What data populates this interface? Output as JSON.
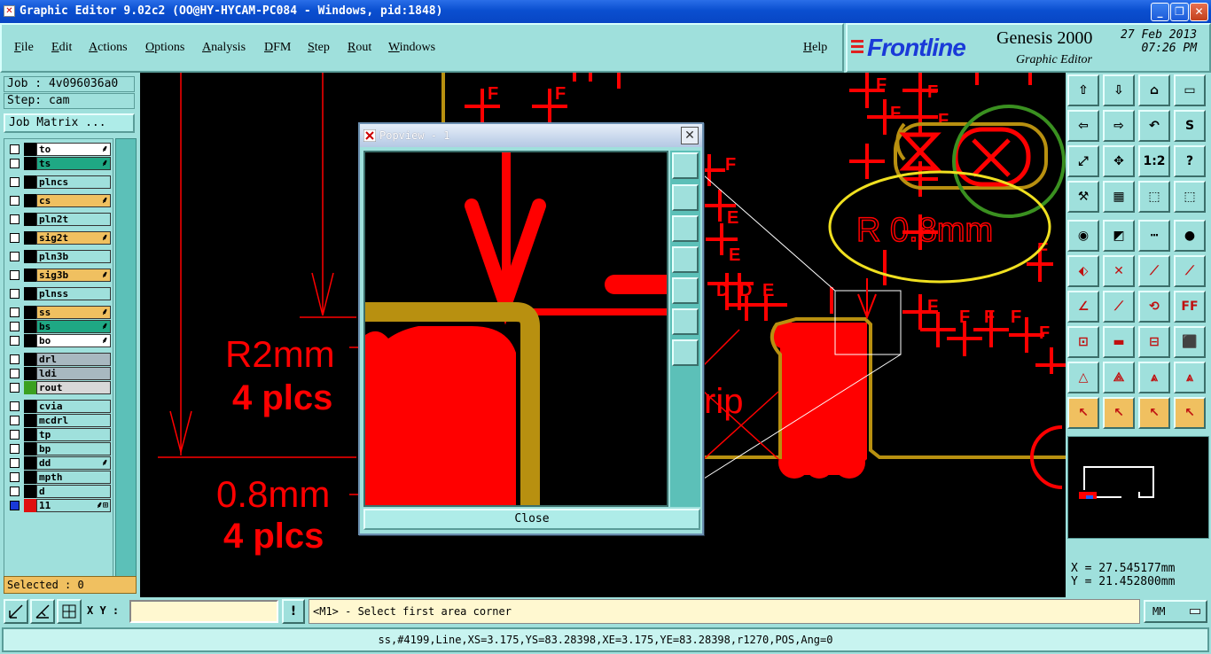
{
  "window": {
    "title": "Graphic Editor 9.02c2 (OO@HY-HYCAM-PC084 - Windows, pid:1848)",
    "min": "_",
    "max": "❐",
    "close": "✕"
  },
  "menu": {
    "items": [
      "File",
      "Edit",
      "Actions",
      "Options",
      "Analysis",
      "DFM",
      "Step",
      "Rout",
      "Windows"
    ],
    "help": "Help"
  },
  "branding": {
    "logo": "Frontline",
    "product": "Genesis 2000",
    "subtitle": "Graphic Editor",
    "date": "27 Feb 2013",
    "time": "07:26 PM"
  },
  "job": {
    "job_label": "Job : 4v096036a0",
    "step_label": "Step: cam",
    "matrix_button": "Job Matrix ..."
  },
  "layers": [
    {
      "name": "to",
      "bg": "#ffffff",
      "swatch": "#000000",
      "mark": "⸙"
    },
    {
      "name": "ts",
      "bg": "#1fa884",
      "swatch": "#000000",
      "mark": "⸙"
    },
    {
      "name": "plncs",
      "bg": "#9fe0dc",
      "swatch": "#000000",
      "mark": ""
    },
    {
      "name": "cs",
      "bg": "#f0c060",
      "swatch": "#000000",
      "mark": "⸙"
    },
    {
      "name": "pln2t",
      "bg": "#9fe0dc",
      "swatch": "#000000",
      "mark": ""
    },
    {
      "name": "sig2t",
      "bg": "#f0c060",
      "swatch": "#000000",
      "mark": "⸙"
    },
    {
      "name": "pln3b",
      "bg": "#9fe0dc",
      "swatch": "#000000",
      "mark": ""
    },
    {
      "name": "sig3b",
      "bg": "#f0c060",
      "swatch": "#000000",
      "mark": "⸙"
    },
    {
      "name": "plnss",
      "bg": "#9fe0dc",
      "swatch": "#000000",
      "mark": ""
    },
    {
      "name": "ss",
      "bg": "#f0c060",
      "swatch": "#000000",
      "mark": "⸙"
    },
    {
      "name": "bs",
      "bg": "#1fa884",
      "swatch": "#000000",
      "mark": "⸙"
    },
    {
      "name": "bo",
      "bg": "#ffffff",
      "swatch": "#000000",
      "mark": "⸙"
    },
    {
      "name": "drl",
      "bg": "#a8b8c0",
      "swatch": "#000000",
      "mark": ""
    },
    {
      "name": "ldi",
      "bg": "#a8b8c0",
      "swatch": "#000000",
      "mark": ""
    },
    {
      "name": "rout",
      "bg": "#d8d8d8",
      "swatch": "#3aa020",
      "mark": ""
    },
    {
      "name": "cvia",
      "bg": "#9fe0dc",
      "swatch": "#000000",
      "mark": ""
    },
    {
      "name": "mcdrl",
      "bg": "#9fe0dc",
      "swatch": "#000000",
      "mark": ""
    },
    {
      "name": "tp",
      "bg": "#9fe0dc",
      "swatch": "#000000",
      "mark": ""
    },
    {
      "name": "bp",
      "bg": "#9fe0dc",
      "swatch": "#000000",
      "mark": ""
    },
    {
      "name": "dd",
      "bg": "#9fe0dc",
      "swatch": "#000000",
      "mark": "⸙"
    },
    {
      "name": "mpth",
      "bg": "#9fe0dc",
      "swatch": "#000000",
      "mark": ""
    },
    {
      "name": "d",
      "bg": "#9fe0dc",
      "swatch": "#000000",
      "mark": ""
    },
    {
      "name": "11",
      "bg": "#9fe0dc",
      "swatch": "#e01010",
      "mark": "⸙⊞"
    }
  ],
  "selected": "Selected : 0",
  "canvas_text": {
    "r2": "R2mm",
    "plcs1": "4 plcs",
    "d08": "0.8mm",
    "plcs2": "4 plcs",
    "r08": "R 0.8mm",
    "rip": "rip"
  },
  "popview": {
    "title": "Popview - 1",
    "close_button": "Close"
  },
  "coords": {
    "x": "X =  27.545177mm",
    "y": "Y =  21.452800mm"
  },
  "bottom": {
    "xy_label": "X Y :",
    "xy_value": "",
    "message": "<M1> - Select first area corner",
    "units": "MM",
    "status": "ss,#4199,Line,XS=3.175,YS=83.28398,XE=3.175,YE=83.28398,r1270,POS,Ang=0"
  },
  "colors": {
    "feature": "#ff0000",
    "rout": "#b89010",
    "panel": "#9fe0dc",
    "highlight": "#f0e020",
    "green_circle": "#3a9020"
  }
}
